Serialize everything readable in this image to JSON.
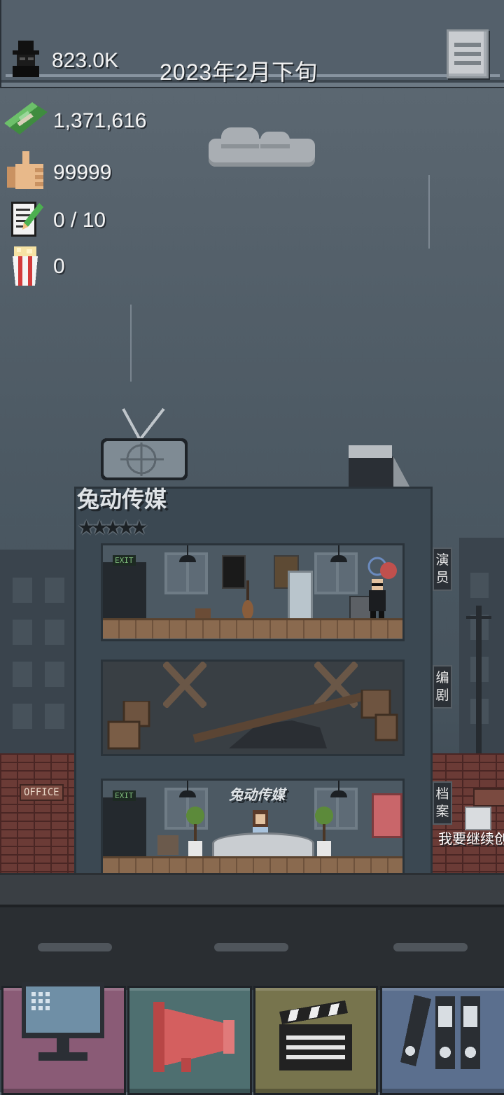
{
  "header": {
    "fame_value": "823.0K",
    "date": "2023年2月下旬",
    "fame_icon": "gangster-hat-icon",
    "menu_icon": "hamburger-menu-icon"
  },
  "resources": {
    "money": "1,371,616",
    "likes": "99999",
    "scripts": "0 / 10",
    "popcorn": "0"
  },
  "building": {
    "company_name": "兔动传媒",
    "reception_sign": "兔动传媒",
    "stars": "★★★★★",
    "star_count": 5,
    "exit_sign": "EXIT",
    "floors": [
      {
        "label": "演员",
        "state": "built"
      },
      {
        "label": "编剧",
        "state": "ruined"
      },
      {
        "label": "档案",
        "state": "built"
      }
    ]
  },
  "scene": {
    "office_sign": "OFFICE",
    "prompt_text": "我要继续创作"
  },
  "toolbar": {
    "buttons": [
      {
        "name": "computer",
        "icon": "computer-icon",
        "color": "#8a5b76"
      },
      {
        "name": "megaphone",
        "icon": "megaphone-icon",
        "color": "#4e6f70"
      },
      {
        "name": "clapperboard",
        "icon": "clapperboard-icon",
        "color": "#77744d"
      },
      {
        "name": "archive",
        "icon": "binders-icon",
        "color": "#5b6f8e"
      }
    ]
  }
}
